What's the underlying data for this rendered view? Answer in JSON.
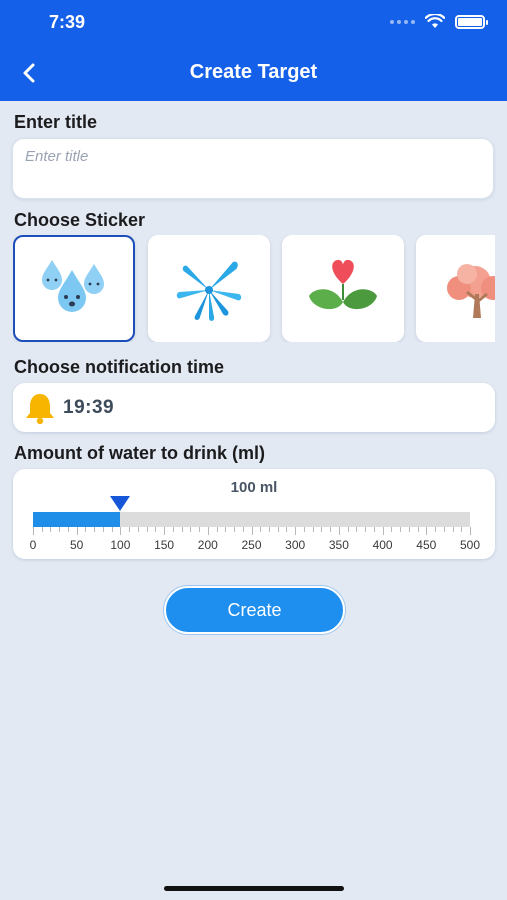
{
  "status_bar": {
    "time": "7:39"
  },
  "header": {
    "title": "Create Target",
    "back_icon": "chevron-left-icon"
  },
  "title_section": {
    "label": "Enter title",
    "placeholder": "Enter title",
    "value": ""
  },
  "sticker_section": {
    "label": "Choose Sticker",
    "stickers": [
      {
        "name": "water-drops-icon",
        "selected": true
      },
      {
        "name": "water-splash-icon",
        "selected": false
      },
      {
        "name": "heart-plant-icon",
        "selected": false
      },
      {
        "name": "tree-icon",
        "selected": false
      }
    ]
  },
  "notification_section": {
    "label": "Choose notification time",
    "icon": "bell-icon",
    "time": "19:39"
  },
  "water_section": {
    "label": "Amount of water to drink (ml)",
    "value_text": "100 ml",
    "value": 100,
    "min": 0,
    "max": 500,
    "tick_labels": [
      "0",
      "50",
      "100",
      "150",
      "200",
      "250",
      "300",
      "350",
      "400",
      "450",
      "500"
    ]
  },
  "actions": {
    "create_label": "Create"
  },
  "colors": {
    "primary": "#1560e8",
    "button": "#1e8fef",
    "background": "#e3e9f2"
  }
}
